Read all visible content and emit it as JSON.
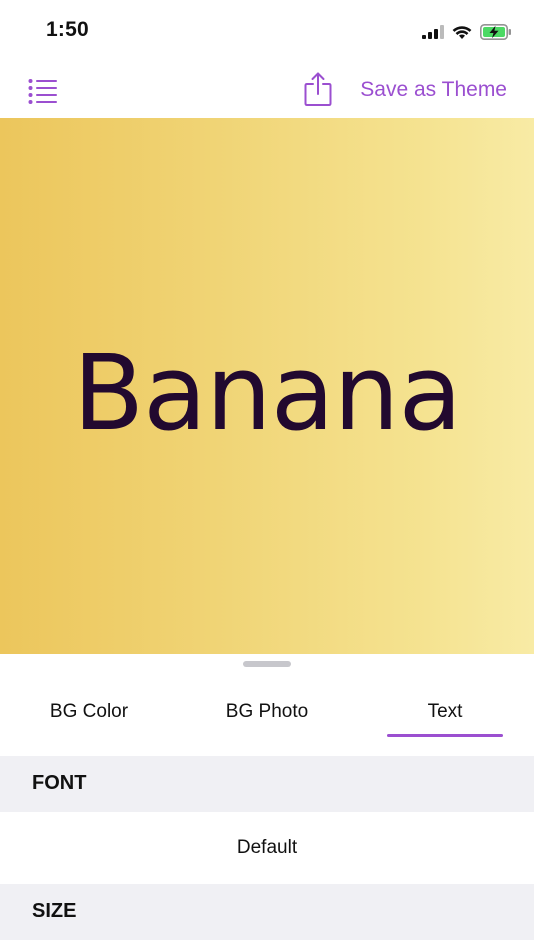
{
  "status_bar": {
    "time": "1:50",
    "icons": [
      "cellular-signal-icon",
      "wifi-icon",
      "battery-charging-icon"
    ]
  },
  "navbar": {
    "menu_icon": "list-icon",
    "share_icon": "share-icon",
    "save_theme_label": "Save as Theme"
  },
  "preview": {
    "text": "Banana",
    "text_color": "#22092f",
    "background_gradient": [
      "#ecc65c",
      "#f8eba5"
    ]
  },
  "tabs": [
    {
      "label": "BG Color",
      "selected": false
    },
    {
      "label": "BG Photo",
      "selected": false
    },
    {
      "label": "Text",
      "selected": true
    }
  ],
  "sections": {
    "font_header": "FONT",
    "font_value": "Default",
    "size_header": "SIZE"
  },
  "colors": {
    "accent": "#9b4fd0",
    "section_bg": "#f0f0f4",
    "battery_green": "#4cd964"
  }
}
